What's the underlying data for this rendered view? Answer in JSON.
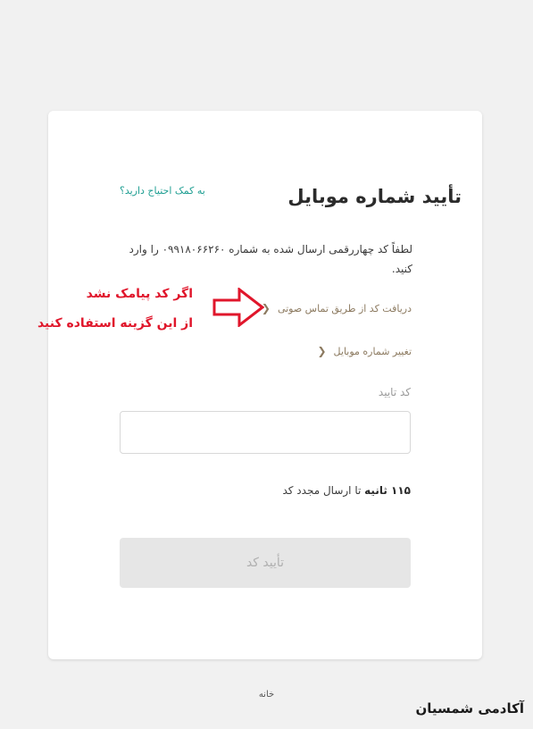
{
  "card": {
    "title": "تأیید شماره موبایل",
    "help_link": "به کمک احتیاج دارید؟",
    "description": "لطفاً کد چهاررقمی ارسال شده به شماره ۰۹۹۱۸۰۶۶۲۶۰ را وارد کنید.",
    "voice_call_link": "دریافت کد از طریق تماس صوتی",
    "change_number_link": "تغییر شماره موبایل",
    "code_label": "کد تایید",
    "code_value": "",
    "timer_value": "۱۱۵ ثانیه",
    "timer_suffix": "تا ارسال مجدد کد",
    "confirm_button": "تأیید کد"
  },
  "annotation": {
    "line1": "اگر کد پیامک نشد",
    "line2": "از این گزینه استفاده کنید",
    "color": "#e0162b"
  },
  "footer": {
    "home_link": "خانه"
  },
  "watermark": {
    "text": "آکادمی شمسیان"
  },
  "colors": {
    "background": "#f1f1f1",
    "card": "#ffffff",
    "accent_teal": "#1e9e92",
    "link_brown": "#8c7a60",
    "button_disabled": "#e6e6e6"
  }
}
